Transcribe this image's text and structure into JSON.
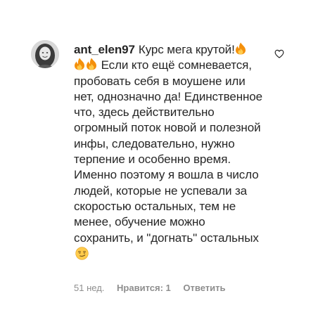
{
  "comment": {
    "username": "ant_elen97",
    "text_first": "Курс мега крутой!",
    "text_rest": "Если кто ещё сомневается, пробовать себя в моушене или нет, однозначно да! Единственное что, здесь действительно огромный поток новой и полезной инфы, следовательно, нужно терпение и особенно время. Именно поэтому я вошла в число людей, которые не успевали за скоростью остальных, тем не менее, обучение можно сохранить, и \"догнать\" остальных",
    "emojis": [
      "fire-icon",
      "fire-icon",
      "fire-icon",
      "smirk-face-icon"
    ]
  },
  "meta": {
    "time": "51 нед.",
    "likes": "Нравится: 1",
    "reply": "Ответить"
  },
  "colors": {
    "text": "#262626",
    "secondary": "#8e8e8e",
    "fire_outer": "#f4900c",
    "fire_inner": "#ffcc4d",
    "emoji_face": "#ffcb4c"
  }
}
